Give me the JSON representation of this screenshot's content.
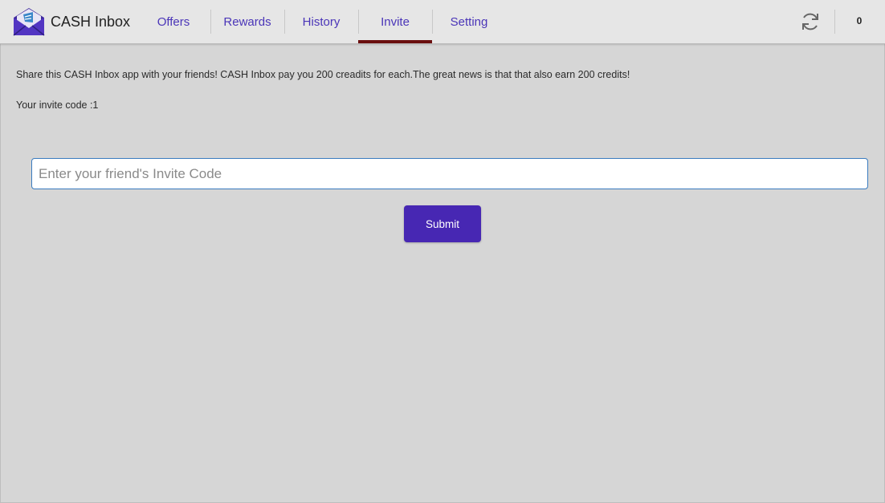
{
  "app": {
    "title": "CASH Inbox",
    "logo_icon": "envelope-logo-icon",
    "brand_color": "#4727b3"
  },
  "tabs": [
    {
      "label": "Offers"
    },
    {
      "label": "Rewards"
    },
    {
      "label": "History"
    },
    {
      "label": "Invite",
      "active": true
    },
    {
      "label": "Setting"
    }
  ],
  "toolbar": {
    "refresh_icon": "refresh-icon",
    "credits": "0"
  },
  "invite": {
    "share_text": "Share this CASH Inbox app with your friends! CASH Inbox pay you 200 creadits for each.The great news is that that also earn 200 credits!",
    "code_text": "Your invite code :1",
    "input_value": "",
    "input_placeholder": "Enter your friend's Invite Code",
    "submit_label": "Submit"
  }
}
